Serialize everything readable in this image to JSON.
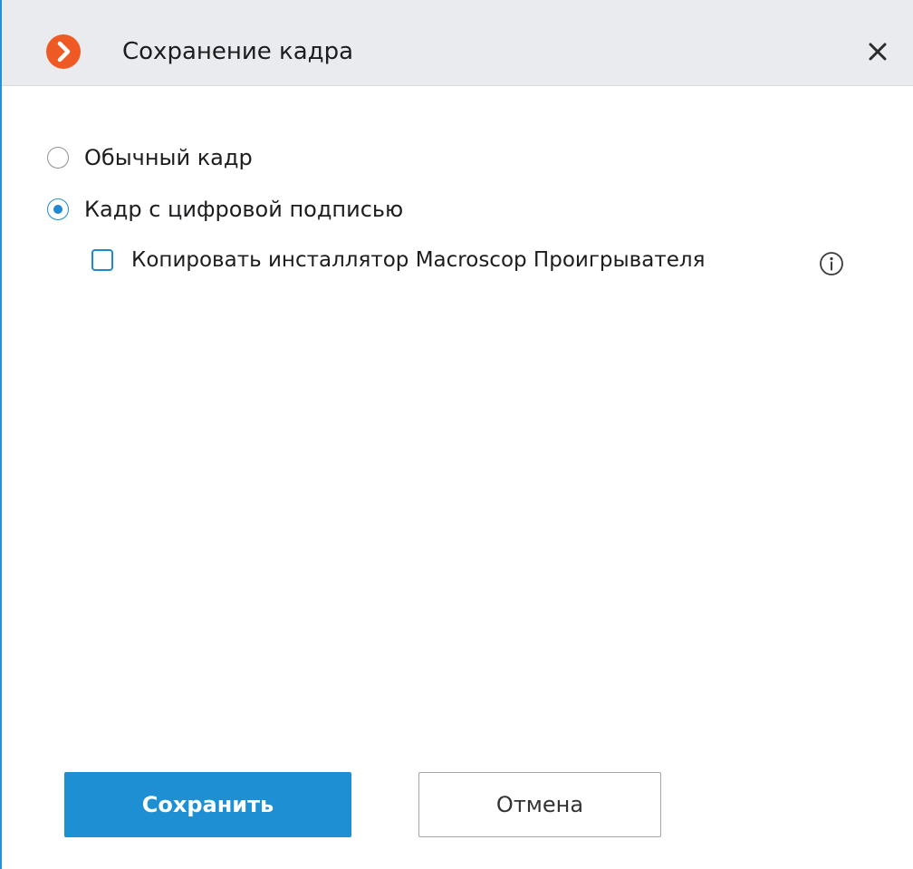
{
  "dialog": {
    "title": "Сохранение кадра",
    "accent_color": "#1f8fd3",
    "logo_color": "#ef5a24",
    "logo_icon": "chevron-right-icon",
    "close_icon": "close-icon"
  },
  "options": {
    "normal_label": "Обычный кадр",
    "normal_selected": false,
    "signed_label": "Кадр с цифровой подписью",
    "signed_selected": true
  },
  "copy_installer": {
    "label": "Копировать инсталлятор Macroscop Проигрывателя",
    "checked": false,
    "info_icon": "info-icon"
  },
  "buttons": {
    "save_label": "Сохранить",
    "cancel_label": "Отмена"
  }
}
